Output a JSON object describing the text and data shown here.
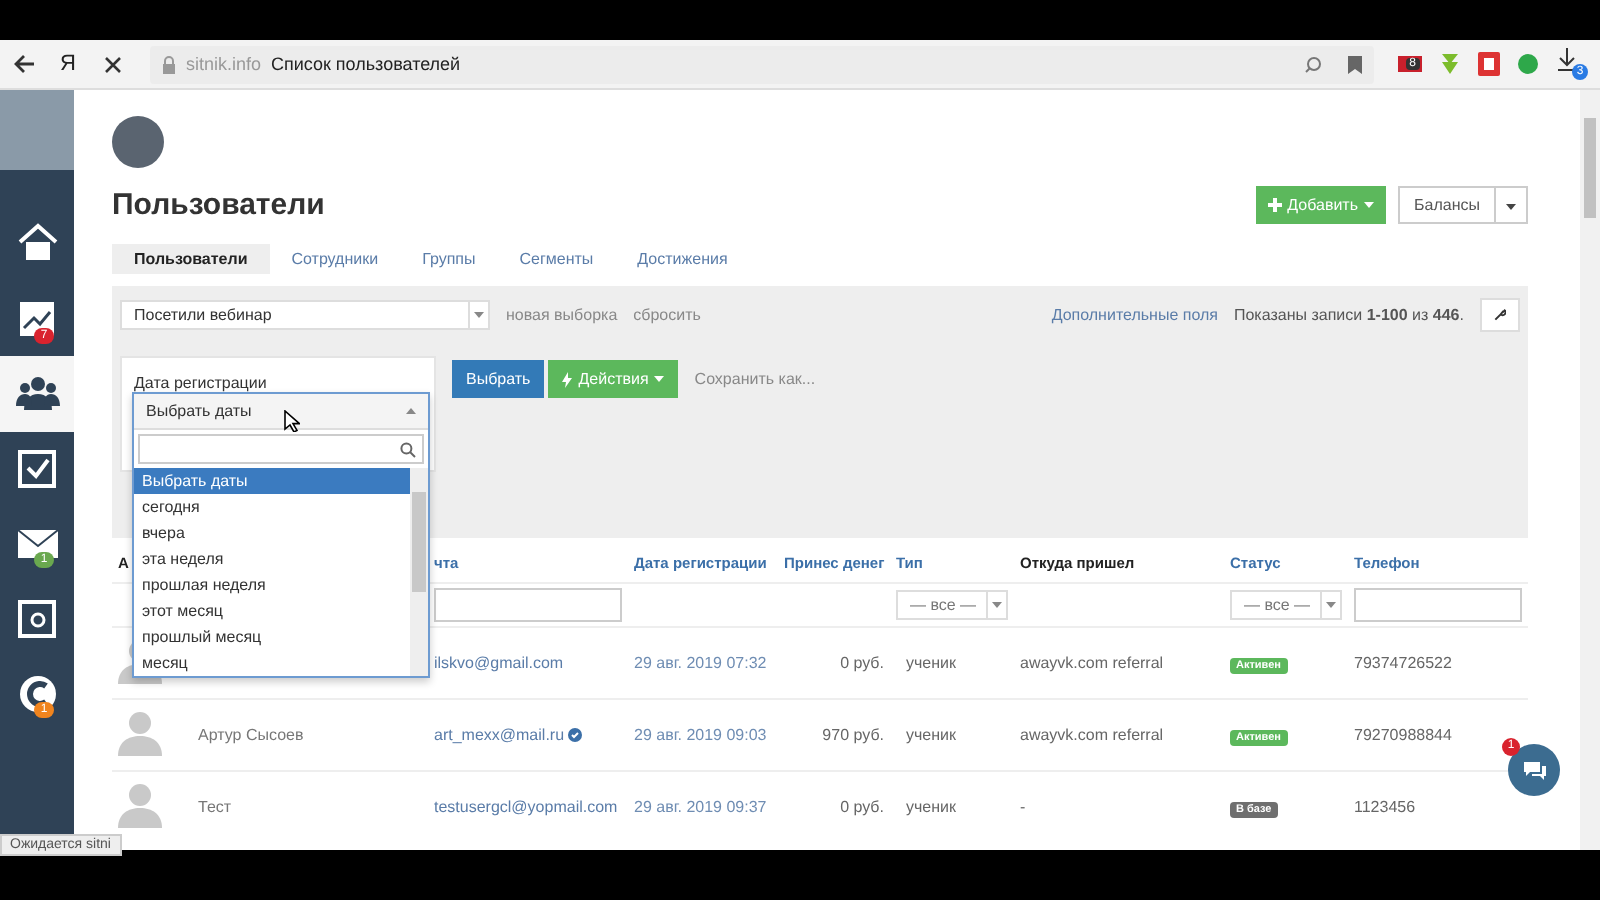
{
  "browser": {
    "logo": "Я",
    "host": "sitnik.info",
    "page_title": "Список пользователей",
    "extension_badge": "8",
    "download_badge": "3"
  },
  "sidebar": {
    "items": [
      {
        "kind": "home",
        "selected": false
      },
      {
        "kind": "chart",
        "selected": false,
        "badge": "7",
        "color": "#d9232e"
      },
      {
        "kind": "users",
        "selected": true
      },
      {
        "kind": "tasks",
        "selected": false
      },
      {
        "kind": "mail",
        "selected": false,
        "badge": "1",
        "color": "#6aa84f"
      },
      {
        "kind": "safe",
        "selected": false
      },
      {
        "kind": "brand",
        "selected": false,
        "badge": "1",
        "color": "#f0841e"
      }
    ]
  },
  "header": {
    "title": "Пользователи",
    "add_button": "Добавить",
    "balance_button": "Балансы"
  },
  "tabs": [
    {
      "label": "Пользователи",
      "selected": true
    },
    {
      "label": "Сотрудники",
      "selected": false
    },
    {
      "label": "Группы",
      "selected": false
    },
    {
      "label": "Сегменты",
      "selected": false
    },
    {
      "label": "Достижения",
      "selected": false
    }
  ],
  "filter": {
    "segment_select": "Посетили вебинар",
    "new_link": "новая выборка",
    "reset_link": "сбросить",
    "extra_fields_link": "Дополнительные поля",
    "records": "Показаны записи **1-100** из **446**.",
    "condition_label": "Дата регистрации",
    "select_button": "Выбрать",
    "actions_button": "Действия",
    "save_link": "Сохранить как..."
  },
  "dropdown": {
    "value": "Выбрать даты",
    "options": [
      {
        "label": "Выбрать даты",
        "selected": true
      },
      {
        "label": "сегодня",
        "selected": false
      },
      {
        "label": "вчера",
        "selected": false
      },
      {
        "label": "эта неделя",
        "selected": false
      },
      {
        "label": "прошлая неделя",
        "selected": false
      },
      {
        "label": "этот месяц",
        "selected": false
      },
      {
        "label": "прошлый месяц",
        "selected": false
      },
      {
        "label": "месяц",
        "selected": false
      }
    ]
  },
  "table": {
    "columns": [
      {
        "label": "А",
        "sortable": false
      },
      {
        "label": "чта",
        "sortable": true
      },
      {
        "label": "Дата регистрации",
        "sortable": true
      },
      {
        "label": "Принес денег",
        "sortable": true
      },
      {
        "label": "Тип",
        "sortable": true
      },
      {
        "label": "Откуда пришел",
        "sortable": false
      },
      {
        "label": "Статус",
        "sortable": true
      },
      {
        "label": "Телефон",
        "sortable": true
      }
    ],
    "type_filter": "— все —",
    "status_filter": "— все —",
    "rows": [
      {
        "email": "ilskvo@gmail.com",
        "verified": false,
        "date": "29 авг. 2019 07:32",
        "money": "0 руб.",
        "type": "ученик",
        "source": "awayvk.com referral",
        "status": "Активен",
        "color": "#5cb85c",
        "phone": "79374726522"
      },
      {
        "name": "Артур Сысоев",
        "email": "art_mexx@mail.ru",
        "verified": true,
        "date": "29 авг. 2019 09:03",
        "money": "970 руб.",
        "type": "ученик",
        "source": "awayvk.com referral",
        "status": "Активен",
        "color": "#5cb85c",
        "phone": "79270988844"
      },
      {
        "name": "Тест",
        "email": "testusergcl@yopmail.com",
        "verified": false,
        "date": "29 авг. 2019 09:37",
        "money": "0 руб.",
        "type": "ученик",
        "source": "-",
        "status": "В базе",
        "color": "#6f6f6f",
        "phone": "1123456"
      }
    ]
  },
  "chat": {
    "badge": "1"
  },
  "status_bar": "Ожидается sitni"
}
